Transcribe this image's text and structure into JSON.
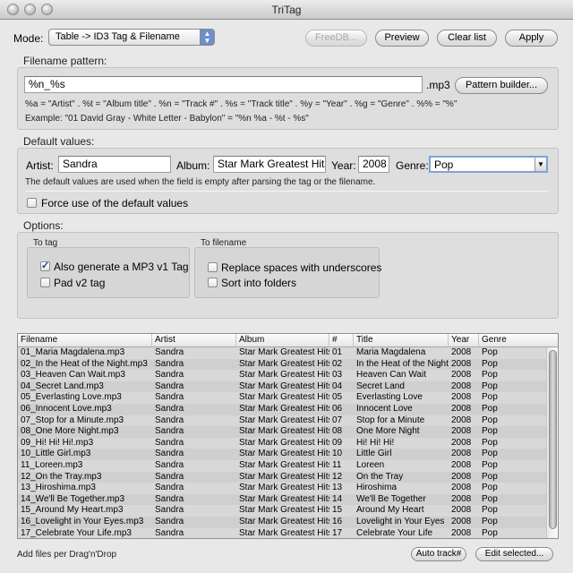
{
  "window": {
    "title": "TriTag"
  },
  "toolbar": {
    "mode_label": "Mode:",
    "mode_value": "Table -> ID3 Tag & Filename",
    "freedb": "FreeDB...",
    "preview": "Preview",
    "clear_list": "Clear list",
    "apply": "Apply"
  },
  "filename_pattern": {
    "section": "Filename pattern:",
    "value": "%n_%s",
    "ext": ".mp3",
    "builder_button": "Pattern builder...",
    "help": "%a = \"Artist\" . %t = \"Album title\" . %n = \"Track #\" . %s = \"Track title\" . %y = \"Year\" . %g = \"Genre\" . %% = \"%\"",
    "example": "Example: \"01 David Gray - White Letter - Babylon\" = \"%n %a - %t - %s\""
  },
  "defaults": {
    "section": "Default values:",
    "artist_label": "Artist:",
    "artist": "Sandra",
    "album_label": "Album:",
    "album": "Star Mark Greatest Hits",
    "year_label": "Year:",
    "year": "2008",
    "genre_label": "Genre:",
    "genre": "Pop",
    "note": "The default values are used when the field is empty after parsing the tag or the filename.",
    "force_label": "Force use of the default values"
  },
  "options": {
    "section": "Options:",
    "to_tag": "To tag",
    "v1_label": "Also generate a MP3 v1 Tag",
    "v1_checked": true,
    "pad_label": "Pad v2 tag",
    "pad_checked": false,
    "to_filename": "To filename",
    "underscores_label": "Replace spaces with underscores",
    "underscores_checked": false,
    "folders_label": "Sort into folders",
    "folders_checked": false
  },
  "table": {
    "columns": [
      "Filename",
      "Artist",
      "Album",
      "#",
      "Title",
      "Year",
      "Genre"
    ],
    "rows": [
      [
        "01_Maria Magdalena.mp3",
        "Sandra",
        "Star Mark Greatest Hits",
        "01",
        "Maria Magdalena",
        "2008",
        "Pop"
      ],
      [
        "02_In the Heat of the Night.mp3",
        "Sandra",
        "Star Mark Greatest Hits",
        "02",
        "In the Heat of the Night",
        "2008",
        "Pop"
      ],
      [
        "03_Heaven Can Wait.mp3",
        "Sandra",
        "Star Mark Greatest Hits",
        "03",
        "Heaven Can Wait",
        "2008",
        "Pop"
      ],
      [
        "04_Secret Land.mp3",
        "Sandra",
        "Star Mark Greatest Hits",
        "04",
        "Secret Land",
        "2008",
        "Pop"
      ],
      [
        "05_Everlasting Love.mp3",
        "Sandra",
        "Star Mark Greatest Hits",
        "05",
        "Everlasting Love",
        "2008",
        "Pop"
      ],
      [
        "06_Innocent Love.mp3",
        "Sandra",
        "Star Mark Greatest Hits",
        "06",
        "Innocent Love",
        "2008",
        "Pop"
      ],
      [
        "07_Stop for a Minute.mp3",
        "Sandra",
        "Star Mark Greatest Hits",
        "07",
        "Stop for a Minute",
        "2008",
        "Pop"
      ],
      [
        "08_One More Night.mp3",
        "Sandra",
        "Star Mark Greatest Hits",
        "08",
        "One More Night",
        "2008",
        "Pop"
      ],
      [
        "09_Hi! Hi! Hi!.mp3",
        "Sandra",
        "Star Mark Greatest Hits",
        "09",
        "Hi! Hi! Hi!",
        "2008",
        "Pop"
      ],
      [
        "10_Little Girl.mp3",
        "Sandra",
        "Star Mark Greatest Hits",
        "10",
        "Little Girl",
        "2008",
        "Pop"
      ],
      [
        "11_Loreen.mp3",
        "Sandra",
        "Star Mark Greatest Hits",
        "11",
        "Loreen",
        "2008",
        "Pop"
      ],
      [
        "12_On the Tray.mp3",
        "Sandra",
        "Star Mark Greatest Hits",
        "12",
        "On the Tray",
        "2008",
        "Pop"
      ],
      [
        "13_Hiroshima.mp3",
        "Sandra",
        "Star Mark Greatest Hits",
        "13",
        "Hiroshima",
        "2008",
        "Pop"
      ],
      [
        "14_We'll Be Together.mp3",
        "Sandra",
        "Star Mark Greatest Hits",
        "14",
        "We'll Be Together",
        "2008",
        "Pop"
      ],
      [
        "15_Around My Heart.mp3",
        "Sandra",
        "Star Mark Greatest Hits",
        "15",
        "Around My Heart",
        "2008",
        "Pop"
      ],
      [
        "16_Lovelight in Your Eyes.mp3",
        "Sandra",
        "Star Mark Greatest Hits",
        "16",
        "Lovelight in Your Eyes",
        "2008",
        "Pop"
      ],
      [
        "17_Celebrate Your Life.mp3",
        "Sandra",
        "Star Mark Greatest Hits",
        "17",
        "Celebrate Your Life",
        "2008",
        "Pop"
      ]
    ]
  },
  "footer": {
    "hint": "Add files per Drag'n'Drop",
    "auto_track": "Auto track#",
    "edit_selected": "Edit selected..."
  }
}
